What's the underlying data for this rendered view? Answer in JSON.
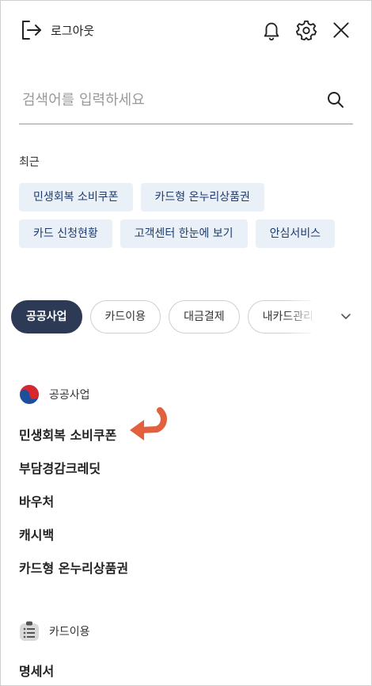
{
  "header": {
    "logout_label": "로그아웃"
  },
  "search": {
    "placeholder": "검색어를 입력하세요"
  },
  "recent": {
    "title": "최근",
    "items": [
      "민생회복 소비쿠폰",
      "카드형 온누리상품권",
      "카드 신청현황",
      "고객센터 한눈에 보기",
      "안심서비스"
    ]
  },
  "tabs": [
    "공공사업",
    "카드이용",
    "대금결제",
    "내카드관리"
  ],
  "active_tab": "공공사업",
  "sections": [
    {
      "title": "공공사업",
      "icon": "taegeuk-icon",
      "items": [
        "민생회복 소비쿠폰",
        "부담경감크레딧",
        "바우처",
        "캐시백",
        "카드형 온누리상품권"
      ]
    },
    {
      "title": "카드이용",
      "icon": "card-usage-icon",
      "items": [
        "명세서"
      ]
    }
  ],
  "colors": {
    "accent_navy": "#2c3a56",
    "chip_bg": "#eaf0f7",
    "chip_text": "#1f3b6e",
    "arrow": "#e2603b"
  }
}
